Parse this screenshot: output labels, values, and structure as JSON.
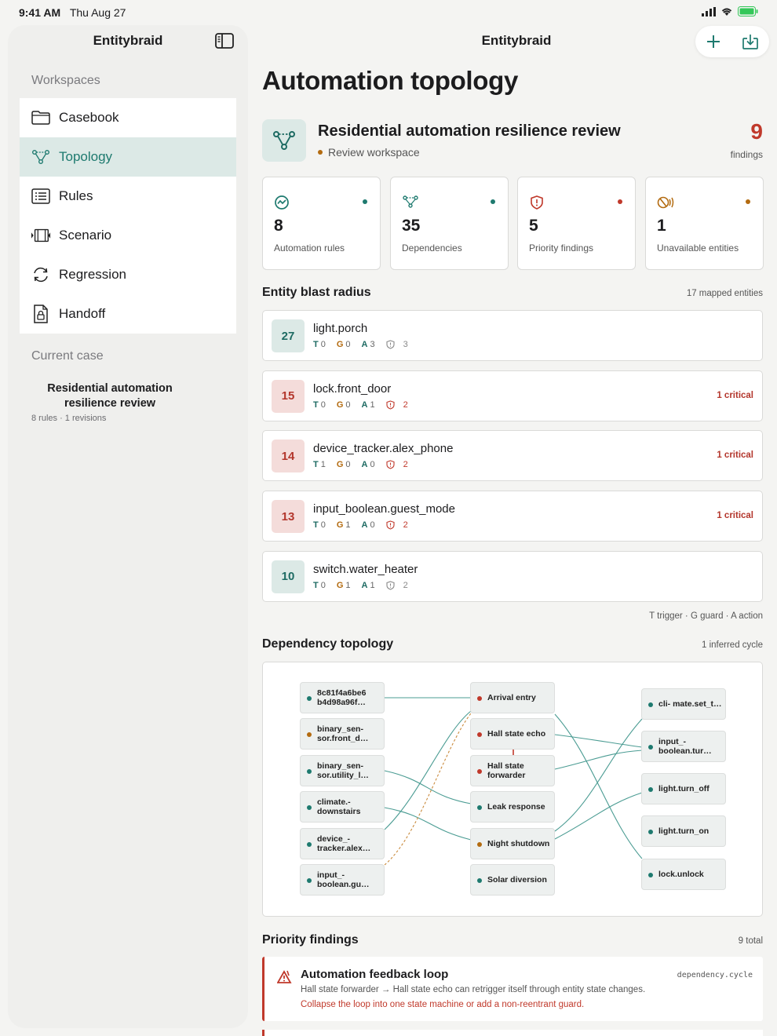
{
  "status": {
    "time": "9:41 AM",
    "date": "Thu Aug 27"
  },
  "app": {
    "name": "Entitybraid"
  },
  "sidebar": {
    "title": "Entitybraid",
    "workspaces_label": "Workspaces",
    "items": [
      {
        "label": "Casebook",
        "icon": "folder-icon"
      },
      {
        "label": "Topology",
        "icon": "topology-icon",
        "active": true
      },
      {
        "label": "Rules",
        "icon": "list-icon"
      },
      {
        "label": "Scenario",
        "icon": "film-icon"
      },
      {
        "label": "Regression",
        "icon": "refresh-icon"
      },
      {
        "label": "Handoff",
        "icon": "lock-document-icon"
      }
    ],
    "current_case_label": "Current case",
    "case_title": "Residential automation resilience review",
    "case_meta": "8 rules · 1 revisions"
  },
  "main": {
    "title": "Automation topology",
    "review": {
      "title": "Residential automation resilience review",
      "subtitle": "Review workspace",
      "findings_count": "9",
      "findings_label": "findings"
    },
    "stats": [
      {
        "value": "8",
        "label": "Automation rules",
        "icon": "activity-icon",
        "dot": "#1e7a6f"
      },
      {
        "value": "35",
        "label": "Dependencies",
        "icon": "topology-icon",
        "dot": "#1e7a6f"
      },
      {
        "value": "5",
        "label": "Priority findings",
        "icon": "shield-alert-icon",
        "dot": "#c0392b"
      },
      {
        "value": "1",
        "label": "Unavailable entities",
        "icon": "signal-off-icon",
        "dot": "#b36b10"
      }
    ],
    "blast": {
      "heading": "Entity blast radius",
      "meta": "17 mapped entities",
      "rows": [
        {
          "score": "27",
          "name": "light.porch",
          "t": "0",
          "g": "0",
          "a": "3",
          "s": "3",
          "critical": "",
          "tone": "teal"
        },
        {
          "score": "15",
          "name": "lock.front_door",
          "t": "0",
          "g": "0",
          "a": "1",
          "s": "2",
          "critical": "1 critical",
          "tone": "red"
        },
        {
          "score": "14",
          "name": "device_tracker.alex_phone",
          "t": "1",
          "g": "0",
          "a": "0",
          "s": "2",
          "critical": "1 critical",
          "tone": "red"
        },
        {
          "score": "13",
          "name": "input_boolean.guest_mode",
          "t": "0",
          "g": "1",
          "a": "0",
          "s": "2",
          "critical": "1 critical",
          "tone": "red"
        },
        {
          "score": "10",
          "name": "switch.water_heater",
          "t": "0",
          "g": "1",
          "a": "1",
          "s": "2",
          "critical": "",
          "tone": "teal"
        }
      ],
      "legend": "T trigger · G guard · A action"
    },
    "topology": {
      "heading": "Dependency topology",
      "meta": "1 inferred cycle",
      "left_nodes": [
        {
          "label": "8c81f4a6be6 b4d98a96f…",
          "dot": "#1e7a6f"
        },
        {
          "label": "binary_sen- sor.front_d…",
          "dot": "#b36b10"
        },
        {
          "label": "binary_sen- sor.utility_l…",
          "dot": "#1e7a6f"
        },
        {
          "label": "climate.- downstairs",
          "dot": "#1e7a6f"
        },
        {
          "label": "device_- tracker.alex…",
          "dot": "#1e7a6f"
        },
        {
          "label": "input_- boolean.gu…",
          "dot": "#1e7a6f"
        }
      ],
      "mid_nodes": [
        {
          "label": "Arrival entry",
          "dot": "#c0392b"
        },
        {
          "label": "Hall state echo",
          "dot": "#c0392b"
        },
        {
          "label": "Hall state forwarder",
          "dot": "#c0392b"
        },
        {
          "label": "Leak response",
          "dot": "#1e7a6f"
        },
        {
          "label": "Night shutdown",
          "dot": "#b36b10"
        },
        {
          "label": "Solar diversion",
          "dot": "#1e7a6f"
        }
      ],
      "right_nodes": [
        {
          "label": "cli- mate.set_t…",
          "dot": "#1e7a6f"
        },
        {
          "label": "input_- boolean.tur…",
          "dot": "#1e7a6f"
        },
        {
          "label": "light.turn_off",
          "dot": "#1e7a6f"
        },
        {
          "label": "light.turn_on",
          "dot": "#1e7a6f"
        },
        {
          "label": "lock.unlock",
          "dot": "#1e7a6f"
        }
      ]
    },
    "priority": {
      "heading": "Priority findings",
      "meta": "9 total",
      "items": [
        {
          "title": "Automation feedback loop",
          "code": "dependency.cycle",
          "description": "Hall state forwarder → Hall state echo can retrigger itself through entity state changes.",
          "fix": "Collapse the loop into one state machine or add a non-reentrant guard."
        }
      ]
    }
  },
  "colors": {
    "accent": "#1e7a6f",
    "critical": "#c0392b",
    "warning": "#b36b10"
  }
}
